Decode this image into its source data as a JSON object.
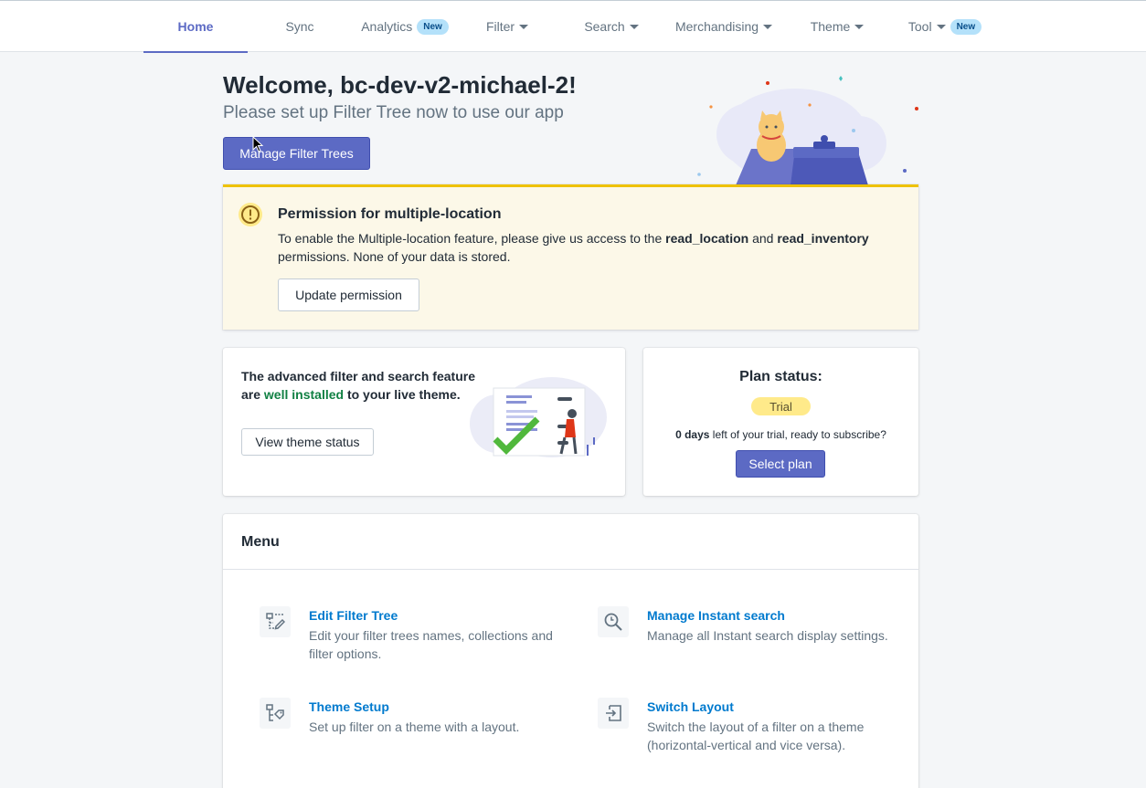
{
  "nav": {
    "items": [
      {
        "label": "Home",
        "active": true
      },
      {
        "label": "Sync"
      },
      {
        "label": "Analytics",
        "badge": "New"
      },
      {
        "label": "Filter",
        "dropdown": true
      },
      {
        "label": "Search",
        "dropdown": true
      },
      {
        "label": "Merchandising",
        "dropdown": true
      },
      {
        "label": "Theme",
        "dropdown": true
      },
      {
        "label": "Tool",
        "dropdown": true,
        "badge": "New"
      }
    ]
  },
  "welcome": {
    "title": "Welcome, bc-dev-v2-michael-2!",
    "subtitle": "Please set up Filter Tree now to use our app",
    "button": "Manage Filter Trees"
  },
  "banner": {
    "title": "Permission for multiple-location",
    "text_before": "To enable the Multiple-location feature, please give us access to the ",
    "perm1": "read_location",
    "text_and": " and ",
    "perm2": "read_inventory",
    "text_after": " permissions. None of your data is stored.",
    "button": "Update permission"
  },
  "theme_card": {
    "text_before": "The advanced filter and search feature are ",
    "highlight": "well installed",
    "text_after": " to your live theme.",
    "button": "View theme status"
  },
  "plan_card": {
    "title": "Plan status:",
    "badge": "Trial",
    "days": "0 days",
    "text": " left of your trial, ready to subscribe?",
    "button": "Select plan"
  },
  "menu": {
    "title": "Menu",
    "items": [
      {
        "label": "Edit Filter Tree",
        "desc": "Edit your filter trees names, collections and filter options.",
        "icon": "filter-tree-edit-icon"
      },
      {
        "label": "Manage Instant search",
        "desc": "Manage all Instant search display settings.",
        "icon": "search-icon"
      },
      {
        "label": "Theme Setup",
        "desc": "Set up filter on a theme with a layout.",
        "icon": "theme-setup-icon"
      },
      {
        "label": "Switch Layout",
        "desc": "Switch the layout of a filter on a theme (horizontal-vertical and vice versa).",
        "icon": "switch-layout-icon"
      }
    ]
  },
  "colors": {
    "primary": "#5c6ac4",
    "link": "#007ace",
    "warning_border": "#eec200",
    "warning_bg": "#fcf8e8",
    "success_text": "#108043",
    "trial_badge": "#ffea8a"
  }
}
